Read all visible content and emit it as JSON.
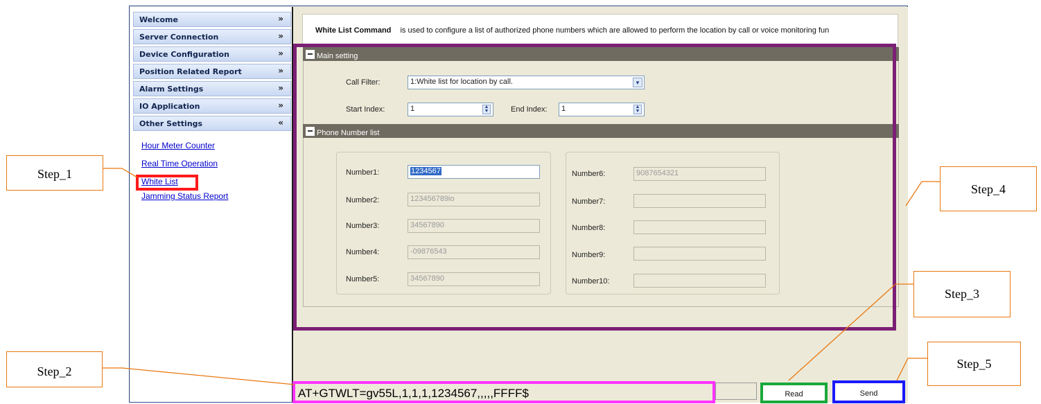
{
  "sidebar": {
    "sections": [
      {
        "label": "Welcome",
        "chevron": "»"
      },
      {
        "label": "Server Connection",
        "chevron": "»"
      },
      {
        "label": "Device Configuration",
        "chevron": "»"
      },
      {
        "label": "Position Related Report",
        "chevron": "»"
      },
      {
        "label": "Alarm Settings",
        "chevron": "»"
      },
      {
        "label": "IO Application",
        "chevron": "»"
      },
      {
        "label": "Other Settings",
        "chevron": "«"
      }
    ],
    "links": [
      "Hour Meter Counter",
      "Real Time Operation",
      "White List",
      "Jamming Status Report"
    ]
  },
  "description": {
    "command": "White List Command",
    "text": "is used to configure a list of authorized phone numbers which are allowed to perform the location by call or voice monitoring fun"
  },
  "main_setting": {
    "title": "Main setting",
    "call_filter_label": "Call Filter:",
    "call_filter_value": "1:White list for location by call.",
    "start_index_label": "Start Index:",
    "start_index_value": "1",
    "end_index_label": "End Index:",
    "end_index_value": "1"
  },
  "phone_list": {
    "title": "Phone Number list",
    "left": [
      {
        "label": "Number1:",
        "value": "1234567"
      },
      {
        "label": "Number2:",
        "value": "123456789io"
      },
      {
        "label": "Number3:",
        "value": "34567890"
      },
      {
        "label": "Number4:",
        "value": "-09876543"
      },
      {
        "label": "Number5:",
        "value": "34567890"
      }
    ],
    "right": [
      {
        "label": "Number6:",
        "value": "9087654321"
      },
      {
        "label": "Number7:",
        "value": ""
      },
      {
        "label": "Number8:",
        "value": ""
      },
      {
        "label": "Number9:",
        "value": ""
      },
      {
        "label": "Number10:",
        "value": ""
      }
    ]
  },
  "command_line": "AT+GTWLT=gv55L,1,1,1,1234567,,,,,FFFF$",
  "buttons": {
    "read": "Read",
    "send": "Send"
  },
  "steps": [
    "Step_1",
    "Step_2",
    "Step_3",
    "Step_4",
    "Step_5"
  ],
  "colors": {
    "step1": "#ff1a1a",
    "step2": "#ff33ff",
    "step3": "#19a83c",
    "step4": "#7b1f74",
    "step5": "#1a1aff",
    "callout_line": "#e9770f"
  }
}
